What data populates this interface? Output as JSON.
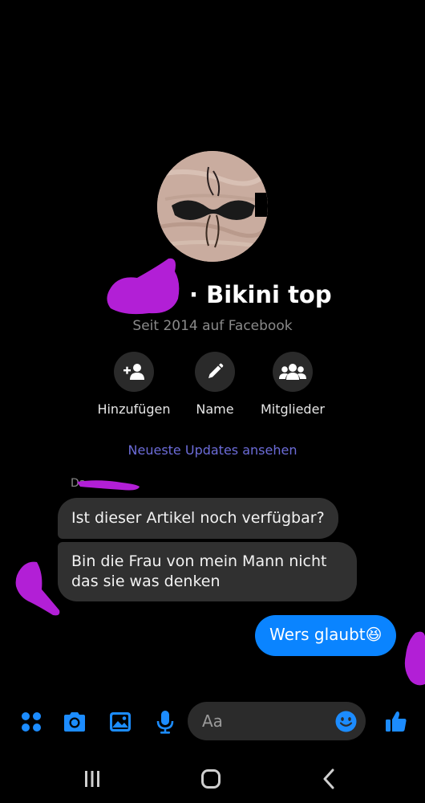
{
  "header": {
    "group_title": "· Bikini top",
    "subtitle": "Seit 2014 auf Facebook"
  },
  "actions": [
    {
      "label": "Hinzufügen",
      "icon": "add-person-icon"
    },
    {
      "label": "Name",
      "icon": "pencil-icon"
    },
    {
      "label": "Mitglieder",
      "icon": "group-icon"
    }
  ],
  "updates_link": "Neueste Updates ansehen",
  "conversation": {
    "sender_name": "Da",
    "incoming": [
      "Ist dieser Artikel noch verfügbar?",
      "Bin die Frau von mein Mann nicht das sie was denken"
    ],
    "outgoing": "Wers glaubt😆"
  },
  "composer": {
    "placeholder": "Aa",
    "icons": [
      "menu-dots-icon",
      "camera-icon",
      "gallery-icon",
      "microphone-icon",
      "emoji-icon",
      "thumbs-up-icon"
    ]
  },
  "system_nav": {
    "icons": [
      "recent-apps-icon",
      "home-icon",
      "back-icon"
    ]
  },
  "colors": {
    "background": "#000000",
    "accent": "#0a84ff",
    "incoming_bubble": "#303030",
    "link": "#6c6cd8",
    "redaction": "#b21fd6"
  }
}
